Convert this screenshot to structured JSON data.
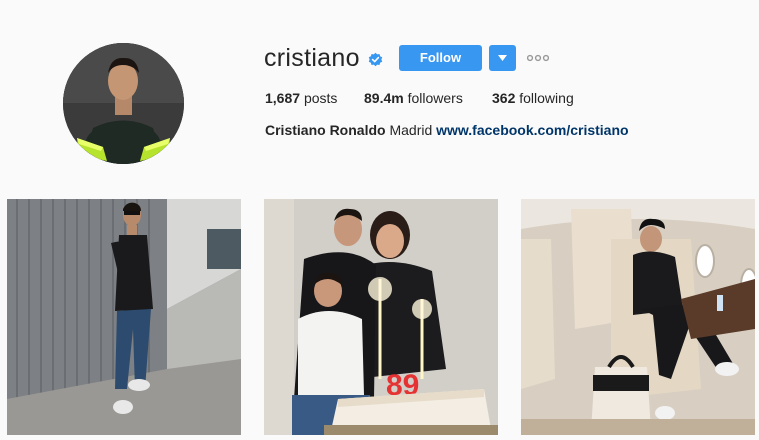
{
  "profile": {
    "username": "cristiano",
    "verified_icon": "verified-badge-icon",
    "follow_label": "Follow",
    "dropdown_icon": "chevron-down-icon",
    "more_icon": "more-options-icon",
    "stats": {
      "posts_count": "1,687",
      "posts_label": "posts",
      "followers_count": "89.4m",
      "followers_label": "followers",
      "following_count": "362",
      "following_label": "following"
    },
    "bio": {
      "full_name": "Cristiano Ronaldo",
      "text": "Madrid",
      "link": "www.facebook.com/cristiano"
    }
  },
  "posts": [
    {
      "name": "post-photo-1"
    },
    {
      "name": "post-photo-2"
    },
    {
      "name": "post-photo-3"
    }
  ],
  "colors": {
    "accent": "#3897f0",
    "link": "#003569",
    "background": "#fafafa",
    "text": "#262626"
  }
}
